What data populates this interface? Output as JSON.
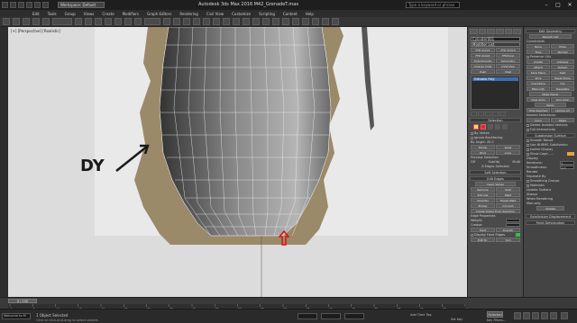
{
  "titlebar": {
    "workspace": "Workspace: Default",
    "title": "Autodesk 3ds Max 2016     M42_GrenadeT.max",
    "search_placeholder": "Type a keyword or phrase",
    "minimize": "–",
    "maximize": "□",
    "close": "✕"
  },
  "menu": [
    "Edit",
    "Tools",
    "Group",
    "Views",
    "Create",
    "Modifiers",
    "Graph Editors",
    "Rendering",
    "Civil View",
    "Customize",
    "Scripting",
    "Content",
    "Help"
  ],
  "viewport": {
    "label": "[+] [Perspective] [Realistic]",
    "annotation": "DY",
    "annotation_color": "#1a1a1a",
    "marker_color": "#e01010"
  },
  "panel": {
    "object_name": "Cylinder001",
    "modifier_list": "Modifier List",
    "modifier_buttons": [
      "FFD 2x2x2",
      "FFD 3x3x3",
      "FFD 4x4x4",
      "FFD(box)",
      "TurboSmooth",
      "Symmetry",
      "Unwrap UVW",
      "UVW Map",
      "Push",
      "Shell"
    ],
    "stack_selected": "Editable Poly",
    "selection_title": "Selection",
    "by_vertex": "By Vertex",
    "ignore_backfacing": "Ignore Backfacing",
    "by_angle": "By Angle: 45.0",
    "shrink": "Shrink",
    "grow": "Grow",
    "ring": "Ring",
    "loop": "Loop",
    "preview_selection": "Preview Selection",
    "preview_opts": [
      "Off",
      "SubObj",
      "Multi"
    ],
    "selected_count": "8 Edges Selected",
    "soft_selection": "Soft Selection",
    "edit_edges": "Edit Edges",
    "edit_edges_buttons": [
      "Insert Vertex",
      "Remove",
      "Split",
      "Extrude",
      "Weld",
      "Chamfer",
      "Target Weld",
      "Bridge",
      "Connect",
      "Create Shape From Selection",
      "Edit Tri.",
      "Turn"
    ],
    "edge_properties": "Edge Properties",
    "weight": "Weight:",
    "crease": "Crease:",
    "hard": "Hard",
    "smooth": "Smooth",
    "display_hard_edges": "Display Hard Edges",
    "edit_geometry": "Edit Geometry",
    "repeat_last": "Repeat Last",
    "constraints": "Constraints",
    "constraint_opts": [
      "None",
      "Edge",
      "Face",
      "Normal"
    ],
    "preserve_uvs": "Preserve UVs",
    "create": "Create",
    "collapse": "Collapse",
    "attach": "Attach",
    "detach": "Detach",
    "slice_plane": "Slice Plane",
    "split": "Split",
    "slice": "Slice",
    "reset_plane": "Reset Plane",
    "quickslice": "QuickSlice",
    "cut": "Cut",
    "msmooth": "MSmooth",
    "tessellate": "Tessellate",
    "make_planar": "Make Planar",
    "view_align": "View Align",
    "grid_align": "Grid Align",
    "relax": "Relax",
    "hide_selected": "Hide Selected",
    "unhide_all": "Unhide All",
    "named_selections": "Named Selections:",
    "copy": "Copy",
    "paste": "Paste",
    "delete_isolated": "Delete Isolated Vertices",
    "full_interactivity": "Full Interactivity",
    "subdivision_surface": "Subdivision Surface",
    "smooth_result": "Smooth Result",
    "use_nurms": "Use NURMS Subdivision",
    "isoline_display": "Isoline Display",
    "show_cage": "Show Cage......",
    "display": "Display",
    "iterations": "Iterations:",
    "iterations_val": "1",
    "smoothness": "Smoothness:",
    "smoothness_val": "1.0",
    "render": "Render",
    "separate_by": "Separate By",
    "smoothing_groups": "Smoothing Groups",
    "materials": "Materials",
    "update_options": "Update Options",
    "always": "Always",
    "when_rendering": "When Rendering",
    "manually": "Manually",
    "update": "Update",
    "subdivision_displacement": "Subdivision Displacement",
    "paint_deformation": "Paint Deformation"
  },
  "timeline": {
    "slider": "0 / 100",
    "ticks": [
      "0",
      "5",
      "10",
      "15",
      "20",
      "25",
      "30",
      "35",
      "40",
      "45",
      "50",
      "55",
      "60",
      "65",
      "70",
      "75",
      "80",
      "85",
      "90",
      "95",
      "100"
    ]
  },
  "statusbar": {
    "maxscript": "Welcome to M",
    "message": "1 Object Selected",
    "hint": "Click or click-and-drag to select objects",
    "add_time_tag": "Add Time Tag",
    "set_key": "Set Key",
    "key_filters": "Key Filters...",
    "selected_dropdown": "Selected"
  }
}
